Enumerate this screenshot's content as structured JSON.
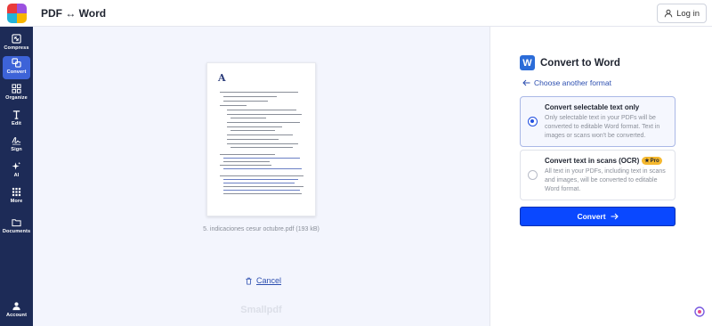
{
  "header": {
    "title": "PDF ↔ Word",
    "login_label": "Log in",
    "logo_colors": [
      "#e93b3b",
      "#9b51e0",
      "#23b3d8",
      "#f7b500"
    ]
  },
  "sidebar": {
    "items": [
      {
        "label": "Compress",
        "icon": "compress-icon",
        "active": false
      },
      {
        "label": "Convert",
        "icon": "convert-icon",
        "active": true
      },
      {
        "label": "Organize",
        "icon": "organize-icon",
        "active": false
      },
      {
        "label": "Edit",
        "icon": "edit-icon",
        "active": false
      },
      {
        "label": "Sign",
        "icon": "sign-icon",
        "active": false
      },
      {
        "label": "AI",
        "icon": "ai-sparkle-icon",
        "active": false
      },
      {
        "label": "More",
        "icon": "more-grid-icon",
        "active": false
      },
      {
        "label": "Documents",
        "icon": "folder-icon",
        "active": false
      }
    ],
    "account_label": "Account"
  },
  "preview": {
    "file_name": "5. indicaciones cesur octubre.pdf (193 kB)",
    "cancel_label": "Cancel",
    "watermark": "Smallpdf"
  },
  "panel": {
    "badge_letter": "W",
    "title": "Convert to Word",
    "another_format_label": "Choose another format",
    "options": [
      {
        "title": "Convert selectable text only",
        "description": "Only selectable text in your PDFs will be converted to editable Word format. Text in images or scans won't be converted.",
        "selected": true
      },
      {
        "title": "Convert text in scans (OCR)",
        "badge": "Pro",
        "description": "All text in your PDFs, including text in scans and images, will be converted to editable Word format.",
        "selected": false
      }
    ],
    "convert_label": "Convert"
  },
  "colors": {
    "sidebar_bg": "#1d2b57",
    "sidebar_active": "#3d63d8",
    "primary_button": "#0a48ff",
    "link": "#2d4fb0",
    "pro_badge": "#f5b82e"
  }
}
